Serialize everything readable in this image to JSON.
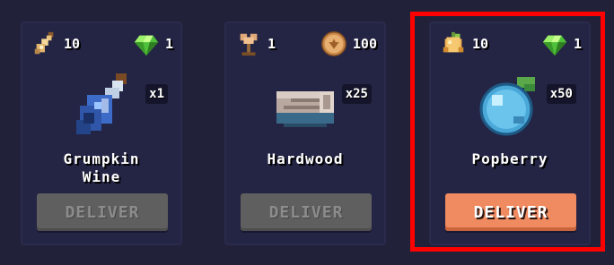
{
  "orders": [
    {
      "cost_left": {
        "icon": "wine-bottle-icon",
        "amount": "10"
      },
      "cost_right": {
        "icon": "gem-icon",
        "amount": "1"
      },
      "item": {
        "name": "Grumpkin\nWine",
        "icon": "grumpkin-wine-bottle-icon",
        "quantity": "x1"
      },
      "button": {
        "label": "DELIVER",
        "state": "disabled"
      }
    },
    {
      "cost_left": {
        "icon": "tree-sapling-icon",
        "amount": "1"
      },
      "cost_right": {
        "icon": "gold-coin-icon",
        "amount": "100"
      },
      "item": {
        "name": "Hardwood",
        "icon": "hardwood-log-icon",
        "quantity": "x25"
      },
      "button": {
        "label": "DELIVER",
        "state": "disabled"
      }
    },
    {
      "cost_left": {
        "icon": "popberry-seed-icon",
        "amount": "10"
      },
      "cost_right": {
        "icon": "gem-icon",
        "amount": "1"
      },
      "item": {
        "name": "Popberry",
        "icon": "popberry-icon",
        "quantity": "x50"
      },
      "button": {
        "label": "DELIVER",
        "state": "active"
      }
    }
  ],
  "highlight": {
    "target": "order-card-popberry",
    "color": "#ff0000"
  },
  "colors": {
    "background": "#21213a",
    "card": "#242444",
    "deliver_active": "#f08a60",
    "deliver_disabled": "#5f5f5f"
  }
}
